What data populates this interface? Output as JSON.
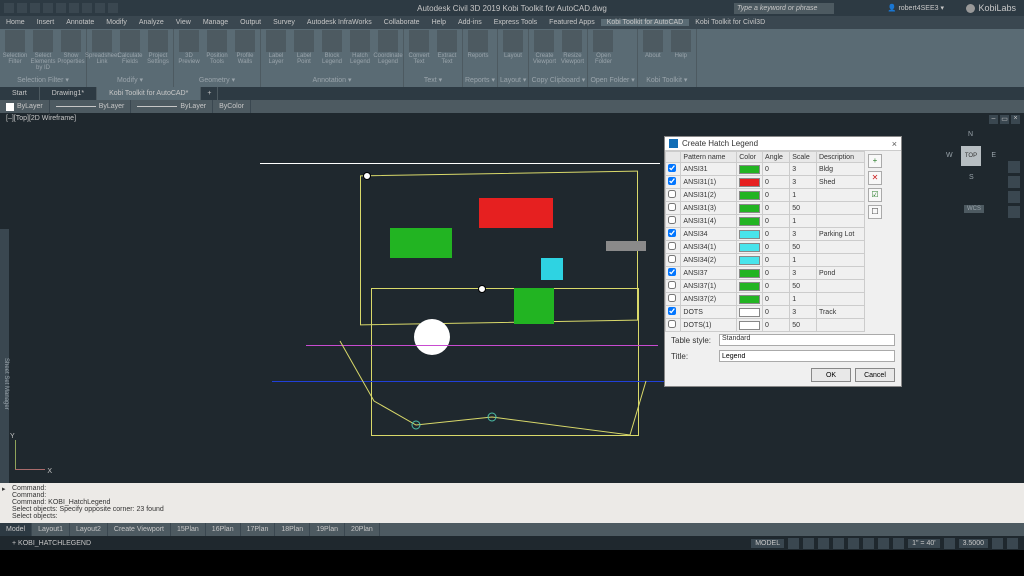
{
  "titlebar": {
    "title": "Autodesk Civil 3D 2019    Kobi Toolkit for AutoCAD.dwg",
    "search_placeholder": "Type a keyword or phrase",
    "user": "robert4SEE3",
    "logo": "KobiLabs"
  },
  "menus": [
    "Home",
    "Insert",
    "Annotate",
    "Modify",
    "Analyze",
    "View",
    "Manage",
    "Output",
    "Survey",
    "Autodesk InfraWorks",
    "Collaborate",
    "Help",
    "Add-ins",
    "Express Tools",
    "Featured Apps",
    "Kobi Toolkit for AutoCAD",
    "Kobi Toolkit for Civil3D"
  ],
  "active_menu": "Kobi Toolkit for AutoCAD",
  "ribbon": {
    "panels": [
      {
        "name": "Selection Filter",
        "btns": [
          "Selection Filter",
          "Select Elements by ID",
          "Show Properties"
        ]
      },
      {
        "name": "Modify",
        "btns": [
          "Spreadsheet Link",
          "Calculate Fields",
          "Project Settings"
        ]
      },
      {
        "name": "Geometry",
        "btns": [
          "3D Preview",
          "Position Tools",
          "Profile Walls"
        ]
      },
      {
        "name": "Annotation",
        "btns": [
          "Label Layer",
          "Label Point",
          "Block Legend",
          "Hatch Legend",
          "Coordinate Legend"
        ]
      },
      {
        "name": "Text",
        "btns": [
          "Convert Text",
          "Extract Text"
        ]
      },
      {
        "name": "Reports",
        "btns": [
          "Reports"
        ]
      },
      {
        "name": "Layout",
        "btns": [
          "Layout"
        ]
      },
      {
        "name": "Copy Clipboard",
        "btns": [
          "Create Viewport",
          "Resize Viewport"
        ]
      },
      {
        "name": "Open Folder",
        "btns": [
          "Open Folder"
        ]
      },
      {
        "name": "Kobi Toolkit",
        "btns": [
          "About",
          "Help"
        ]
      }
    ]
  },
  "tabs": [
    "Start",
    "Drawing1*",
    "Kobi Toolkit for AutoCAD*"
  ],
  "active_tab": "Kobi Toolkit for AutoCAD*",
  "propbar": {
    "layer": "ByLayer",
    "ltype": "ByLayer",
    "lweight": "ByLayer",
    "color": "ByColor"
  },
  "viewport": {
    "label": "[–][Top][2D Wireframe]",
    "cube": "TOP",
    "wcs": "WCS",
    "ucs_y": "Y",
    "ucs_x": "X"
  },
  "dialog": {
    "title": "Create Hatch Legend",
    "headers": [
      "",
      "Pattern name",
      "Color",
      "Angle",
      "Scale",
      "Description"
    ],
    "rows": [
      {
        "on": true,
        "name": "ANSI31",
        "color": "#22b422",
        "angle": "0",
        "scale": "3",
        "desc": "Bldg"
      },
      {
        "on": true,
        "name": "ANSI31(1)",
        "color": "#e62020",
        "angle": "0",
        "scale": "3",
        "desc": "Shed"
      },
      {
        "on": false,
        "name": "ANSI31(2)",
        "color": "#22b422",
        "angle": "0",
        "scale": "1",
        "desc": ""
      },
      {
        "on": false,
        "name": "ANSI31(3)",
        "color": "#22b422",
        "angle": "0",
        "scale": "50",
        "desc": ""
      },
      {
        "on": false,
        "name": "ANSI31(4)",
        "color": "#22b422",
        "angle": "0",
        "scale": "1",
        "desc": ""
      },
      {
        "on": true,
        "name": "ANSI34",
        "color": "#48e4ec",
        "angle": "0",
        "scale": "3",
        "desc": "Parking Lot"
      },
      {
        "on": false,
        "name": "ANSI34(1)",
        "color": "#48e4ec",
        "angle": "0",
        "scale": "50",
        "desc": ""
      },
      {
        "on": false,
        "name": "ANSI34(2)",
        "color": "#48e4ec",
        "angle": "0",
        "scale": "1",
        "desc": ""
      },
      {
        "on": true,
        "name": "ANSI37",
        "color": "#22b422",
        "angle": "0",
        "scale": "3",
        "desc": "Pond"
      },
      {
        "on": false,
        "name": "ANSI37(1)",
        "color": "#22b422",
        "angle": "0",
        "scale": "50",
        "desc": ""
      },
      {
        "on": false,
        "name": "ANSI37(2)",
        "color": "#22b422",
        "angle": "0",
        "scale": "1",
        "desc": ""
      },
      {
        "on": true,
        "name": "DOTS",
        "color": "#ffffff",
        "angle": "0",
        "scale": "3",
        "desc": "Track"
      },
      {
        "on": false,
        "name": "DOTS(1)",
        "color": "#ffffff",
        "angle": "0",
        "scale": "50",
        "desc": ""
      }
    ],
    "table_style_label": "Table style:",
    "table_style": "Standard",
    "title_label": "Title:",
    "title_val": "Legend",
    "ok": "OK",
    "cancel": "Cancel"
  },
  "cmd": {
    "lines": [
      "Command:",
      "Command:",
      "Command: KOBI_HatchLegend",
      "Select objects: Specify opposite corner: 23 found",
      "Select objects:"
    ]
  },
  "layouts": [
    "Model",
    "Layout1",
    "Layout2",
    "Create Viewport",
    "15Plan",
    "16Plan",
    "17Plan",
    "18Plan",
    "19Plan",
    "20Plan"
  ],
  "status": {
    "space": "MODEL",
    "angle": "1\" = 40'",
    "scale": "3.5000",
    "cmd": "+  KOBI_HATCHLEGEND"
  },
  "ssm": "Sheet Set Manager"
}
